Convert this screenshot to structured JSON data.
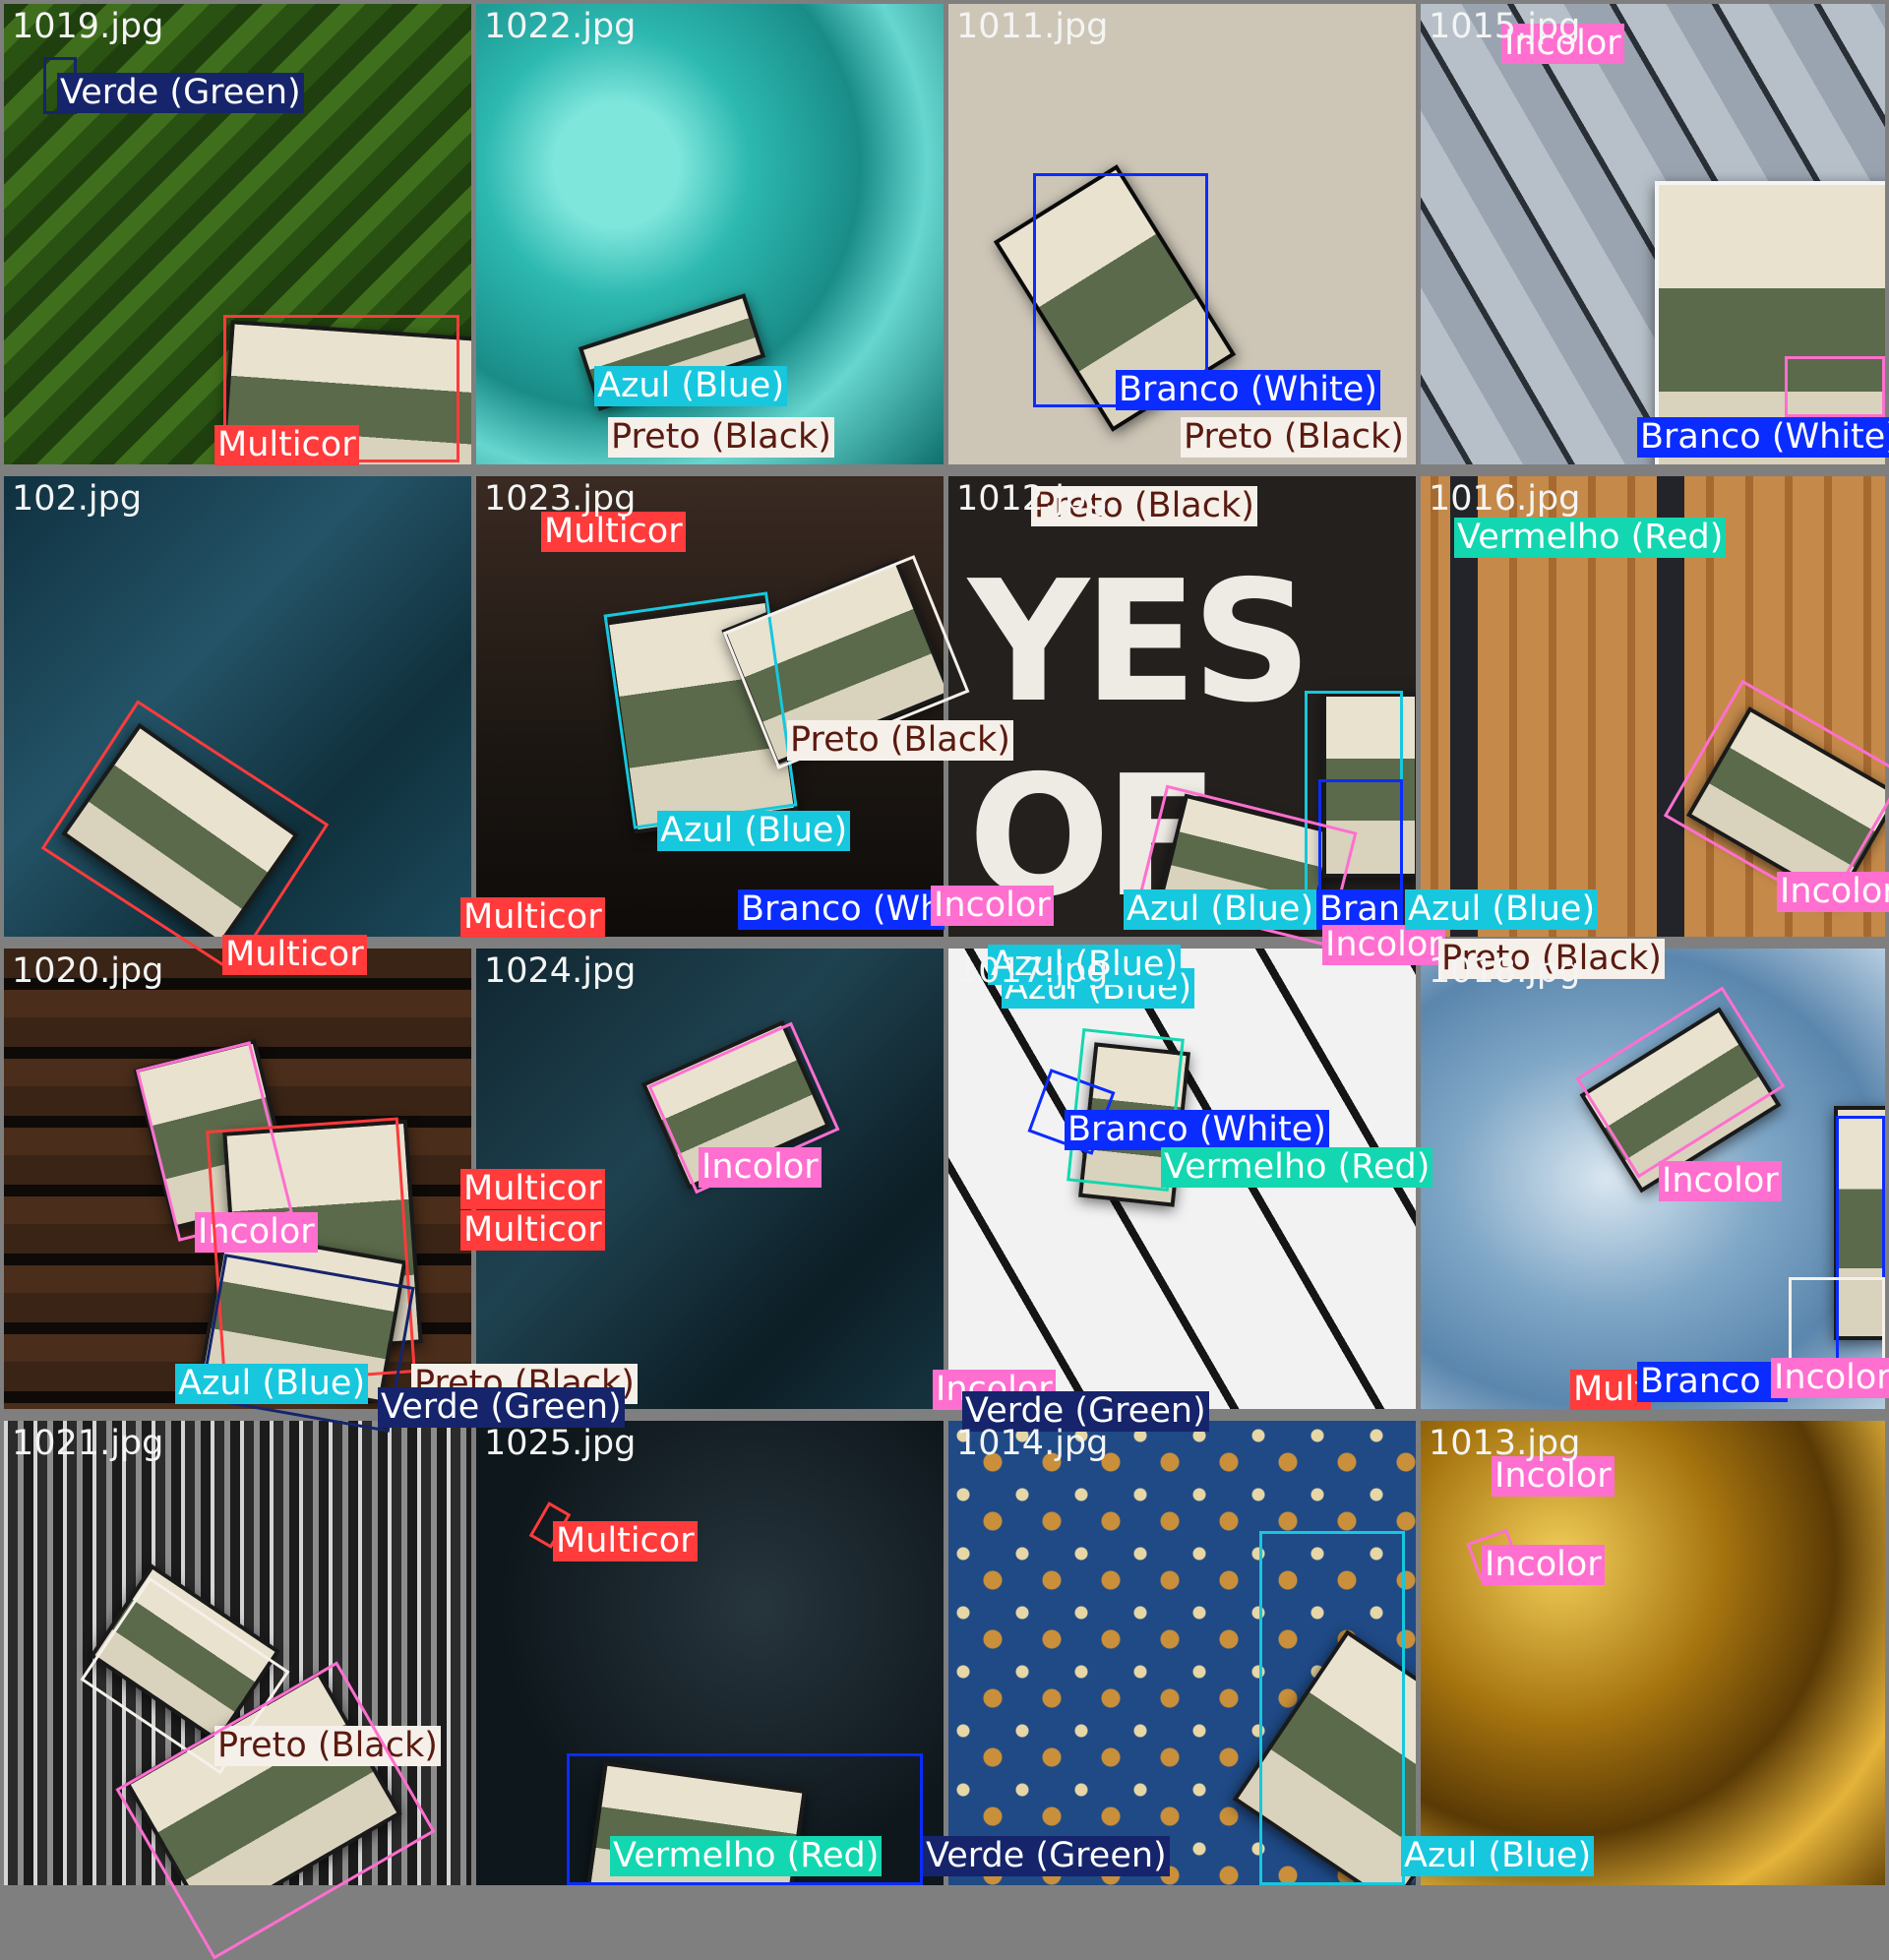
{
  "tiles": [
    {
      "filename": "1019.jpg"
    },
    {
      "filename": "1022.jpg"
    },
    {
      "filename": "1011.jpg"
    },
    {
      "filename": "1015.jpg"
    },
    {
      "filename": "102.jpg"
    },
    {
      "filename": "1023.jpg"
    },
    {
      "filename": "1012.jpg"
    },
    {
      "filename": "1016.jpg"
    },
    {
      "filename": "1020.jpg"
    },
    {
      "filename": "1024.jpg"
    },
    {
      "filename": "1017.jpg"
    },
    {
      "filename": "1018.jpg"
    },
    {
      "filename": "1021.jpg"
    },
    {
      "filename": "1025.jpg"
    },
    {
      "filename": "1014.jpg"
    },
    {
      "filename": "1013.jpg"
    }
  ],
  "classes": {
    "verde": "Verde (Green)",
    "azul": "Azul (Blue)",
    "preto": "Preto (Black)",
    "incolor": "Incolor",
    "multi": "Multicor",
    "branco": "Branco (White)",
    "vermelho": "Vermelho (Red)"
  },
  "class_colors": {
    "verde": "#16246b",
    "azul": "#17c7dd",
    "preto": "#f5f0ea",
    "incolor": "#ff6fd0",
    "multi": "#ff3b3b",
    "branco": "#0b2cff",
    "vermelho": "#13d7b0"
  },
  "truncated_labels": {
    "branco_wh": "Branco (Wh",
    "branco_bran": "Bran",
    "multi_mult": "Mult",
    "branco_open": "Branco ("
  }
}
